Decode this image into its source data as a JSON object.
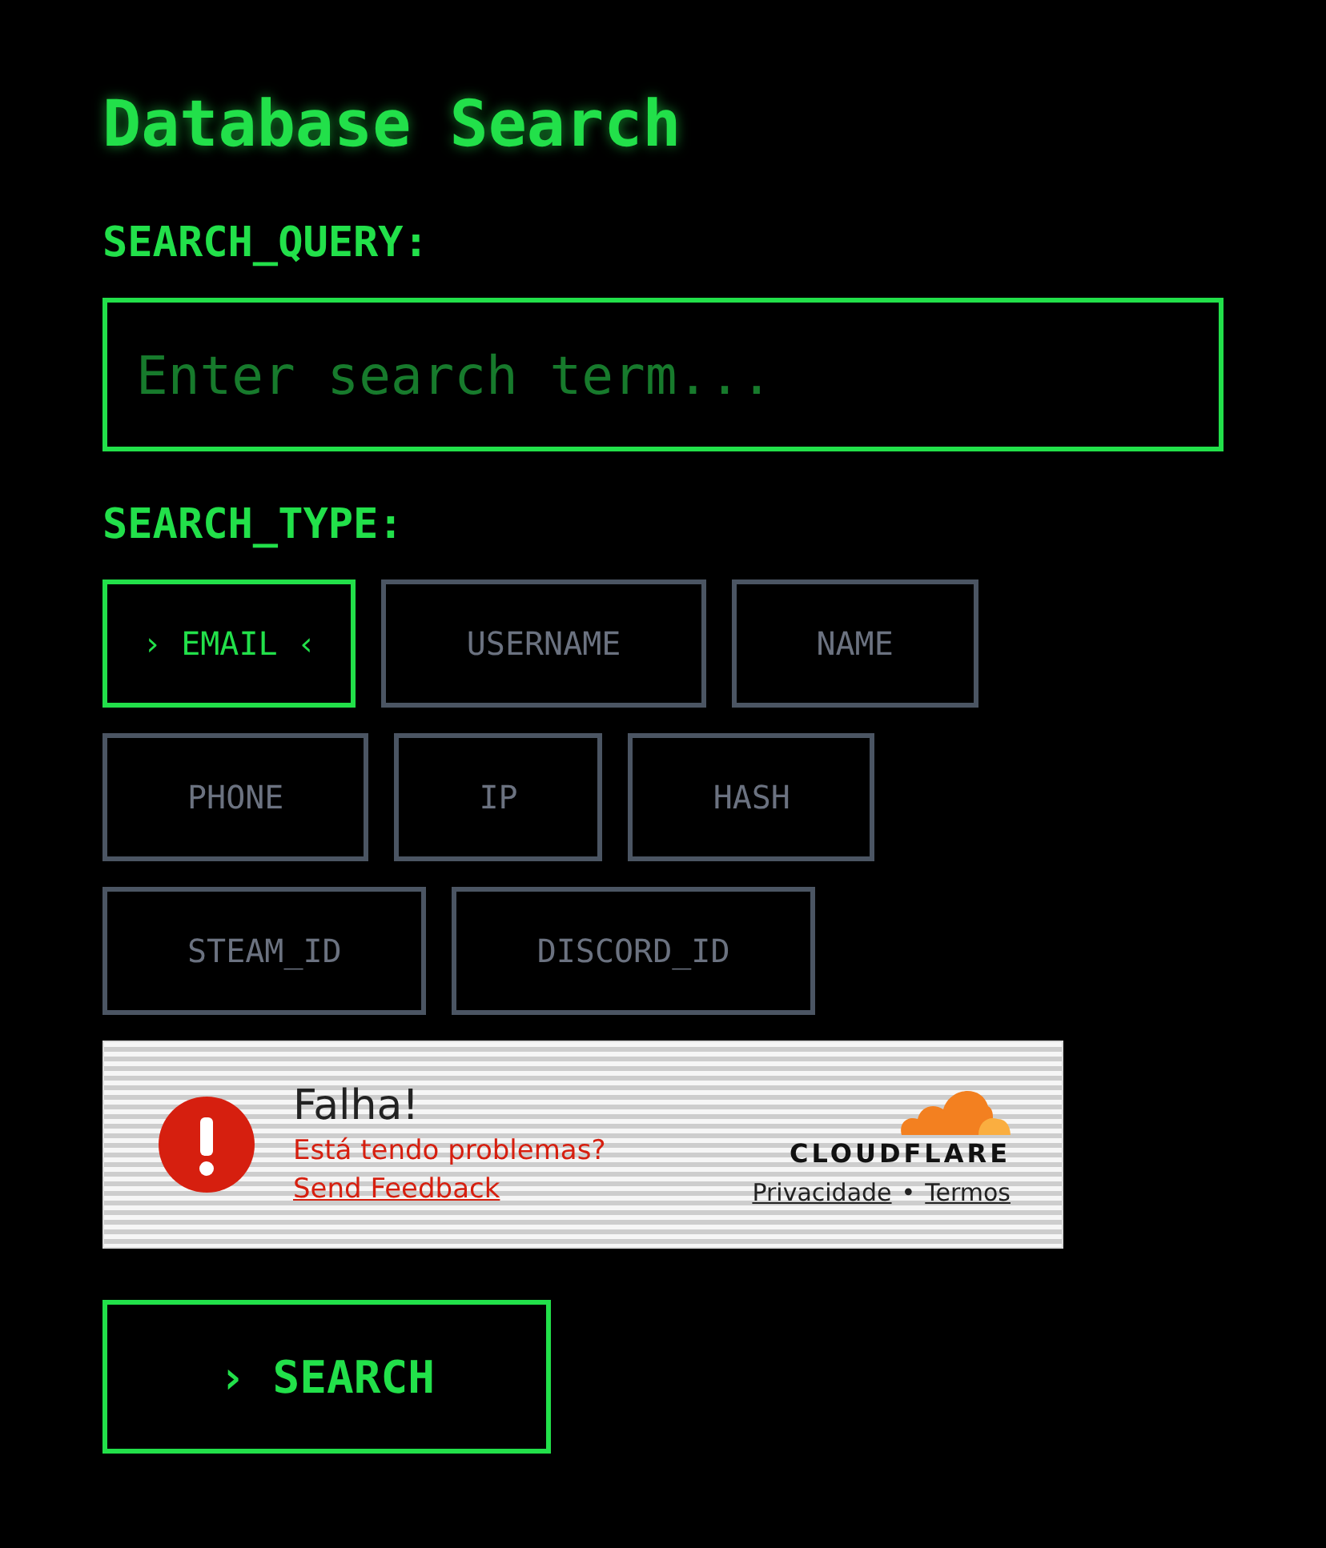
{
  "title": "Database Search",
  "query": {
    "label": "SEARCH_QUERY:",
    "placeholder": "Enter search term..."
  },
  "search_type": {
    "label": "SEARCH_TYPE:",
    "selected_marks": {
      "left": "›",
      "right": "‹"
    },
    "options": [
      {
        "label": "EMAIL",
        "selected": true
      },
      {
        "label": "USERNAME",
        "selected": false
      },
      {
        "label": "NAME",
        "selected": false
      },
      {
        "label": "PHONE",
        "selected": false
      },
      {
        "label": "IP",
        "selected": false
      },
      {
        "label": "HASH",
        "selected": false
      },
      {
        "label": "STEAM_ID",
        "selected": false
      },
      {
        "label": "DISCORD_ID",
        "selected": false
      }
    ]
  },
  "captcha": {
    "status": "Falha!",
    "message": "Está tendo problemas?",
    "feedback_link": "Send Feedback",
    "brand": "CLOUDFLARE",
    "links": [
      "Privacidade",
      "Termos"
    ],
    "separator": "•"
  },
  "submit": {
    "icon": "›",
    "label": "SEARCH"
  }
}
